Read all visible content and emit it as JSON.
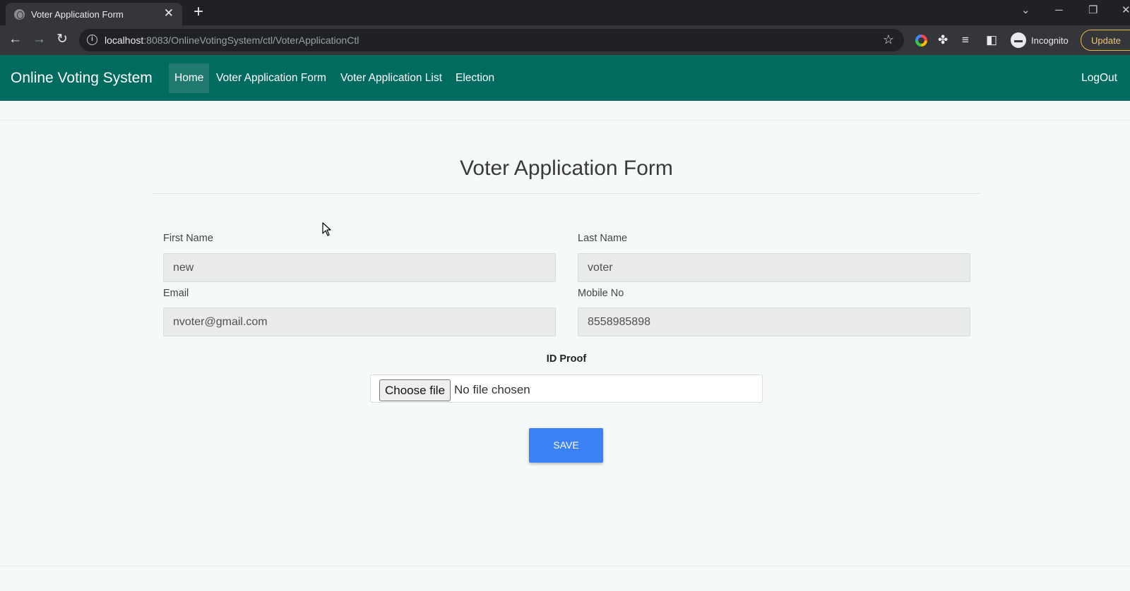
{
  "browser": {
    "tab_title": "Voter Application Form",
    "url_host": "localhost",
    "url_path": ":8083/OnlineVotingSystem/ctl/VoterApplicationCtl",
    "profile_label": "Incognito",
    "update_label": "Update"
  },
  "nav": {
    "brand": "Online Voting System",
    "items": [
      {
        "label": "Home",
        "active": true
      },
      {
        "label": "Voter Application Form"
      },
      {
        "label": "Voter Application List"
      },
      {
        "label": "Election"
      }
    ],
    "logout": "LogOut",
    "color": "#006b5e"
  },
  "form": {
    "title": "Voter Application Form",
    "first_name": {
      "label": "First Name",
      "value": "new"
    },
    "last_name": {
      "label": "Last Name",
      "value": "voter"
    },
    "email": {
      "label": "Email",
      "value": "nvoter@gmail.com"
    },
    "mobile": {
      "label": "Mobile No",
      "value": "8558985898"
    },
    "id_proof": {
      "label": "ID Proof",
      "button": "Choose file",
      "status": "No file chosen"
    },
    "save": "SAVE",
    "save_color": "#3b82f6"
  }
}
